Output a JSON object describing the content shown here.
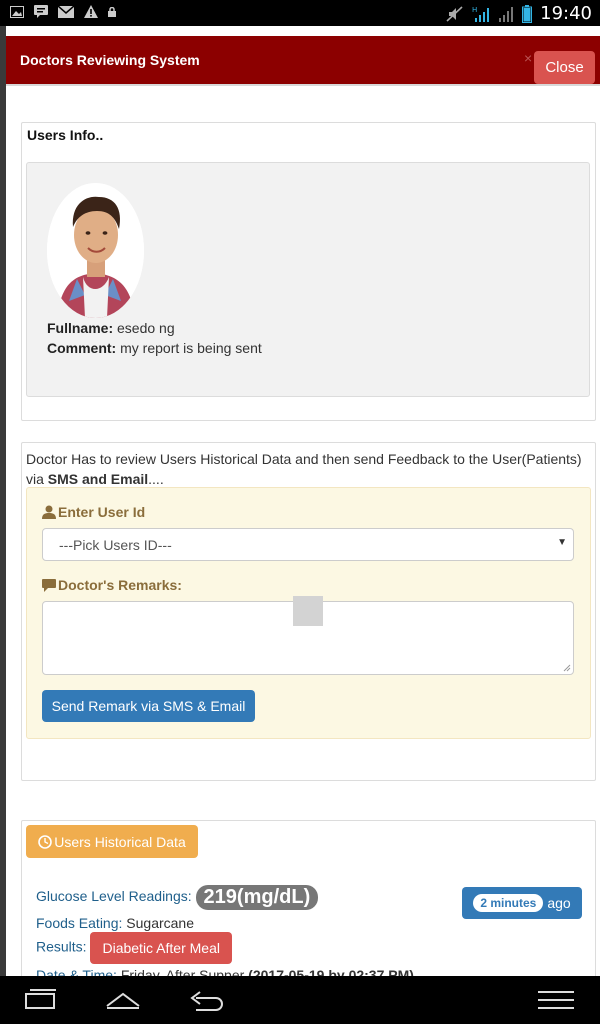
{
  "status_bar": {
    "time": "19:40",
    "left_icons": [
      "image-icon",
      "message-icon",
      "mail-icon",
      "warning-icon",
      "lock-icon"
    ],
    "right_icons": [
      "mute-icon",
      "signal-h-icon",
      "signal-icon",
      "battery-icon"
    ]
  },
  "header": {
    "title": "Doctors Reviewing System",
    "close_x": "×",
    "close_label": "Close",
    "color": "#8c0000"
  },
  "users_info": {
    "title": "Users Info..",
    "fullname_label": "Fullname:",
    "fullname_value": "esedo ng",
    "comment_label": "Comment:",
    "comment_value": "my report is being sent"
  },
  "review": {
    "intro_text": "Doctor Has to review Users Historical Data and then send Feedback to the User(Patients) via",
    "intro_bold": "SMS and Email",
    "intro_tail": "....",
    "user_id_label": "Enter User Id",
    "select_value": "---Pick Users ID---",
    "remarks_label": "Doctor's Remarks:",
    "remarks_value": "",
    "send_button": "Send Remark via SMS & Email"
  },
  "history": {
    "button_label": "Users Historical Data",
    "glucose_label": "Glucose Level Readings:",
    "glucose_value": "219(mg/dL)",
    "foods_label": "Foods Eating:",
    "foods_value": "Sugarcane",
    "results_label": "Results:",
    "results_value": "Diabetic After Meal",
    "time_badge": "2 minutes",
    "time_suffix": "ago",
    "datetime_label": "Date & Time:",
    "datetime_value": "Friday, After Supper",
    "datetime_bold": "(2017-05-19 by 02:37 PM)"
  },
  "colors": {
    "primary": "#337ab7",
    "danger": "#d9534f",
    "warning": "#f0ad4e",
    "form_bg": "#fcf8e3",
    "label_gold": "#8a6d3b"
  }
}
